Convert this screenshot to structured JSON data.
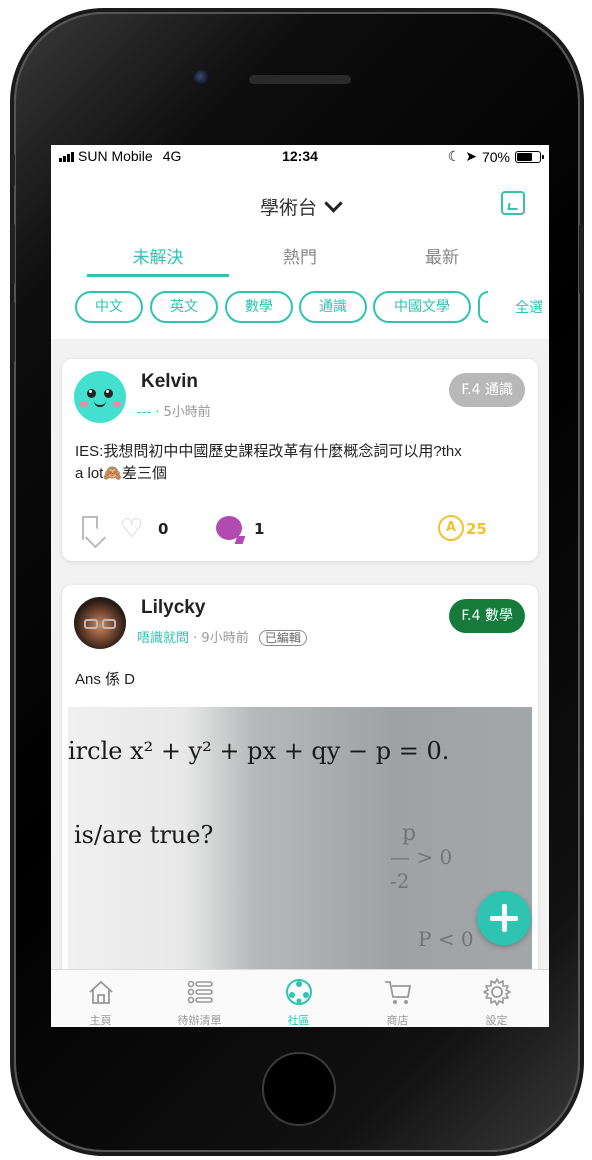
{
  "status_bar": {
    "carrier": "SUN Mobile",
    "network": "4G",
    "time": "12:34",
    "battery": "70%",
    "battery_level": 0.7
  },
  "header": {
    "title": "學術台",
    "compose_icon": "compose-icon"
  },
  "tabs": [
    {
      "label": "未解決",
      "active": true
    },
    {
      "label": "熱門",
      "active": false
    },
    {
      "label": "最新",
      "active": false
    }
  ],
  "filters": {
    "chips": [
      "中文",
      "英文",
      "數學",
      "通識",
      "中國文學"
    ],
    "select_all": "全選"
  },
  "posts": [
    {
      "username": "Kelvin",
      "handle": "---",
      "time": "5小時前",
      "edited": "",
      "badge": "F.4 通識",
      "badge_color": "#b8b8b8",
      "body_line1": "IES:我想問初中中國歷史課程改革有什麼概念詞可以用?thx",
      "body_line2": "a lot🙈差三個",
      "likes": "0",
      "comments": "1",
      "coins": "25"
    },
    {
      "username": "Lilycky",
      "handle": "唔識就問",
      "time": "9小時前",
      "edited": "已編輯",
      "badge": "F.4 數學",
      "badge_color": "#157a3a",
      "body_line1": "Ans 係 D",
      "photo_line1": "ircle x² + y² + px + qy − p = 0.",
      "photo_line2": "is/are true?"
    }
  ],
  "bottom_nav": [
    {
      "label": "主頁",
      "icon": "home-icon",
      "active": false
    },
    {
      "label": "待辦清單",
      "icon": "todo-list-icon",
      "active": false
    },
    {
      "label": "社區",
      "icon": "community-icon",
      "active": true
    },
    {
      "label": "商店",
      "icon": "cart-icon",
      "active": false
    },
    {
      "label": "設定",
      "icon": "gear-icon",
      "active": false
    }
  ],
  "colors": {
    "accent": "#2fc4b2",
    "comment": "#b14ab1",
    "coin": "#f2c12e"
  }
}
